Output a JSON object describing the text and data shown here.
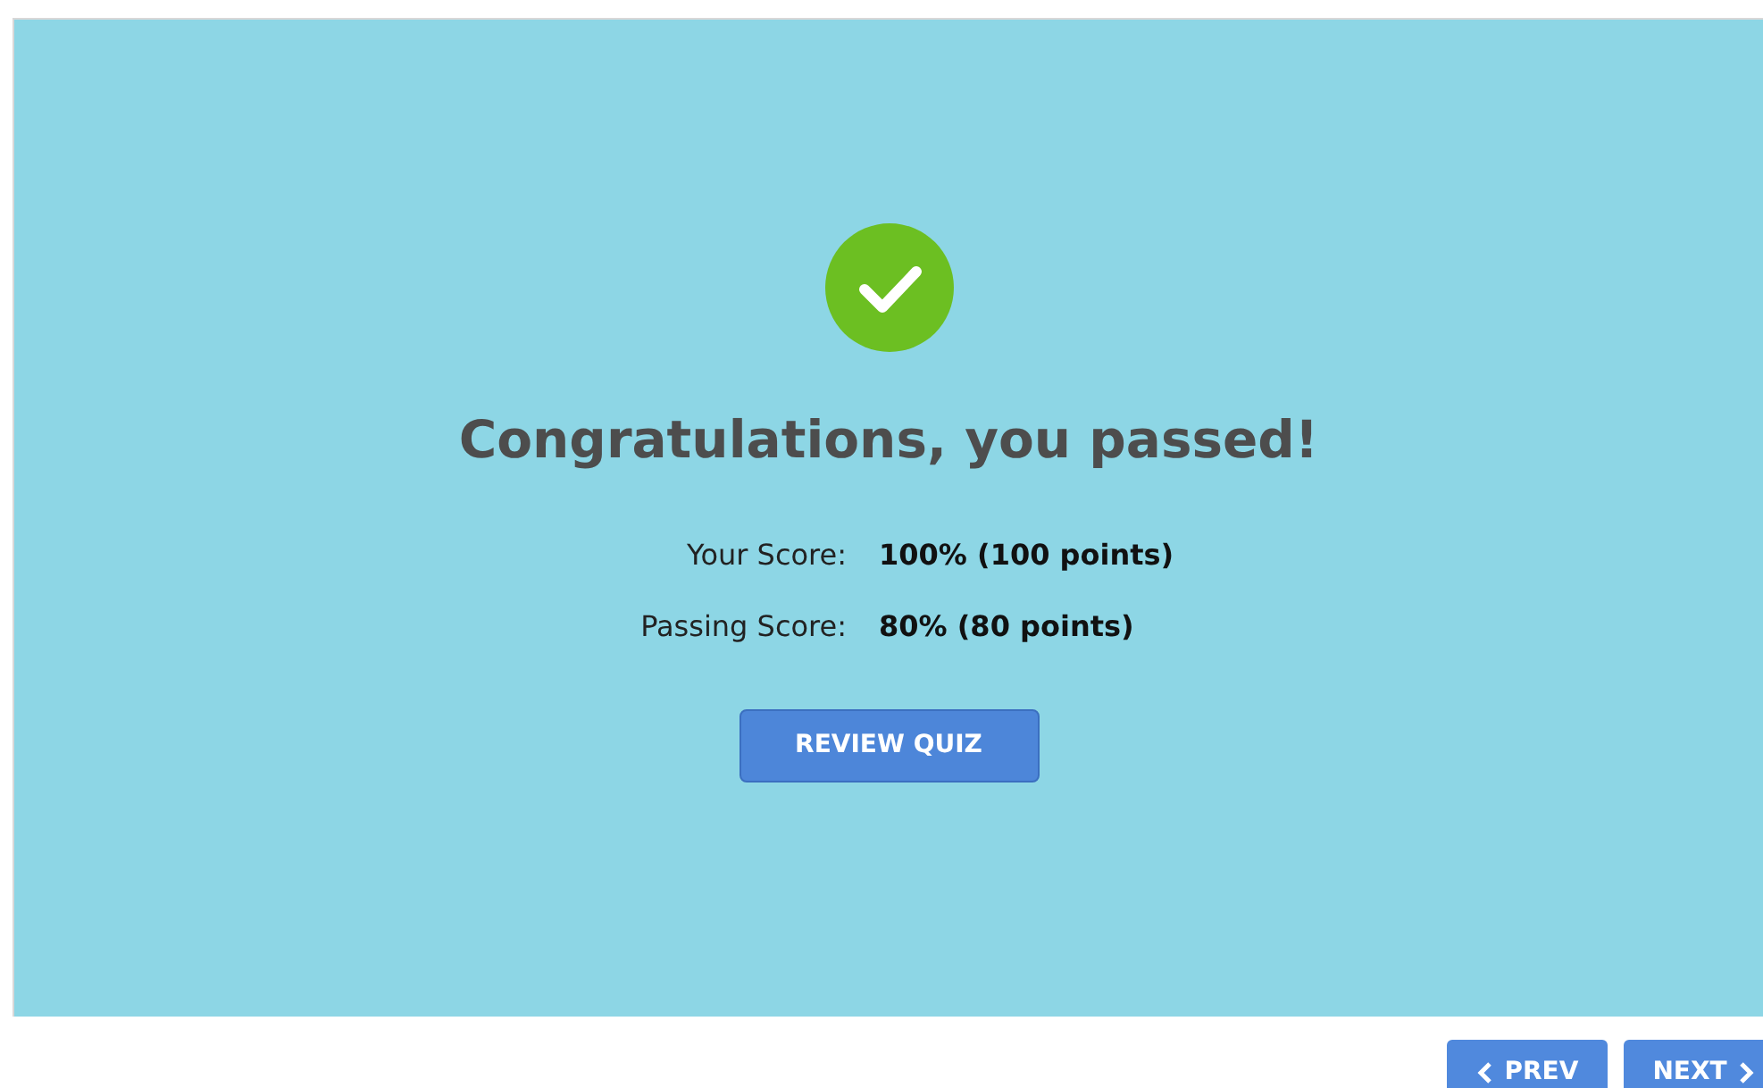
{
  "result": {
    "passed": true,
    "title": "Congratulations, you passed!",
    "scores": [
      {
        "label": "Your Score:",
        "value": "100% (100 points)"
      },
      {
        "label": "Passing Score:",
        "value": "80% (80 points)"
      }
    ],
    "review_button": "REVIEW QUIZ"
  },
  "navigation": [
    {
      "kind": "prev",
      "label": "PREV"
    },
    {
      "kind": "next",
      "label": "NEXT"
    }
  ]
}
